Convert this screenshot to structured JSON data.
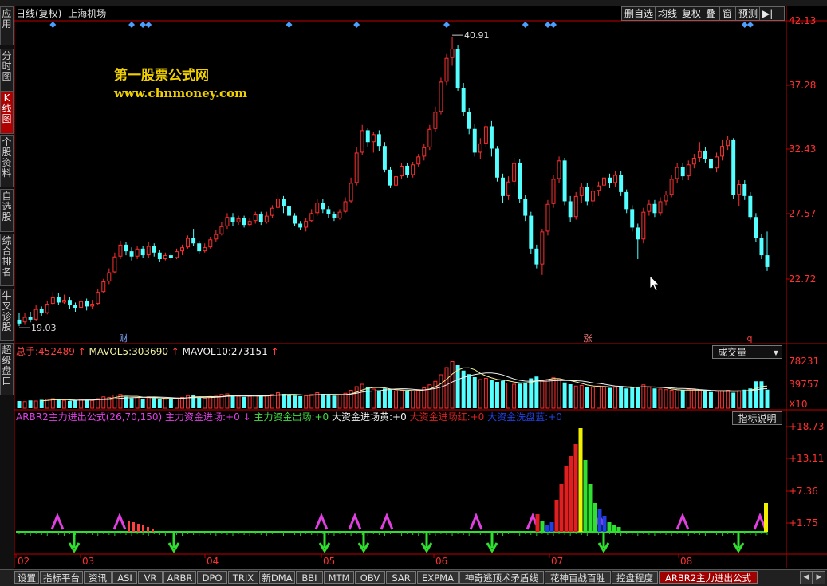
{
  "title": {
    "period": "日线(复权)",
    "stock": "上海机场"
  },
  "toolbar": [
    "删自选",
    "均线",
    "复权",
    "叠",
    "窗",
    "预测"
  ],
  "sidebar": [
    {
      "label": "应\n用"
    },
    {
      "label": "分\n时\n图"
    },
    {
      "label": "K\n线\n图"
    },
    {
      "label": "个\n股\n资\n料"
    },
    {
      "label": "自\n选\n股"
    },
    {
      "label": "综\n合\n排\n名"
    },
    {
      "label": "牛\n叉\n诊\n股"
    },
    {
      "label": "超\n级\n盘\n口"
    }
  ],
  "watermark": {
    "line1": "第一股票公式网",
    "line2": "www.chnmoney.com"
  },
  "price_axis": [
    "42.13",
    "37.28",
    "32.43",
    "27.57",
    "22.72"
  ],
  "price_annotations": {
    "high": "40.91",
    "low": "19.03"
  },
  "event_markers": [
    "财",
    "涨",
    "q"
  ],
  "volume_panel": {
    "label_total": "总手:",
    "total": "452489",
    "ma5_label": "MAVOL5:",
    "ma5": "303690",
    "ma10_label": "MAVOL10:",
    "ma10": "273151",
    "selector": "成交量",
    "axis": [
      "78231",
      "39757",
      "X10"
    ]
  },
  "indicator_panel": {
    "name": "ARBR2主力进出公式(26,70,150)",
    "items": [
      {
        "label": "主力资金进场:",
        "value": "+0",
        "color": "#e040e0"
      },
      {
        "label": "主力资金出场:",
        "value": "+0",
        "color": "#40e040"
      },
      {
        "label": "大资金进场黄:",
        "value": "+0",
        "color": "#f0f0f0"
      },
      {
        "label": "大资金进场红:",
        "value": "+0",
        "color": "#e02020"
      },
      {
        "label": "大资金洗盘蓝:",
        "value": "+0",
        "color": "#2040e0"
      }
    ],
    "button": "指标说明",
    "axis": [
      "+18.73",
      "+13.11",
      "+7.36",
      "+1.75"
    ]
  },
  "months": [
    "02",
    "03",
    "04",
    "05",
    "06",
    "07",
    "08"
  ],
  "bottom_tabs": [
    "设置",
    "指标平台",
    "资讯",
    "ASI",
    "VR",
    "ARBR",
    "DPO",
    "TRIX",
    "新DMA",
    "BBI",
    "MTM",
    "OBV",
    "SAR",
    "EXPMA",
    "神奇逃顶术矛盾线",
    "花神百战百胜",
    "控盘程度",
    "ARBR2主力进出公式"
  ],
  "colors": {
    "up": "#ff3030",
    "down": "#54ffff",
    "axis": "#c00000",
    "bg": "#000000"
  },
  "chart_data": {
    "type": "candlestick",
    "price_range": [
      19.03,
      42.13
    ],
    "candles": [
      [
        19.4,
        19.1,
        19.9,
        18.9
      ],
      [
        19.2,
        19.6,
        19.9,
        19.0
      ],
      [
        19.6,
        19.4,
        20.0,
        19.2
      ],
      [
        19.4,
        20.2,
        20.5,
        19.3
      ],
      [
        20.2,
        19.9,
        20.4,
        19.7
      ],
      [
        19.9,
        20.6,
        20.8,
        19.8
      ],
      [
        20.6,
        21.1,
        21.5,
        20.5
      ],
      [
        21.1,
        20.7,
        21.4,
        20.5
      ],
      [
        20.7,
        20.9,
        21.3,
        20.6
      ],
      [
        20.9,
        20.5,
        21.1,
        20.2
      ],
      [
        20.5,
        20.3,
        20.7,
        20.0
      ],
      [
        20.3,
        20.8,
        21.0,
        20.2
      ],
      [
        20.8,
        20.4,
        21.0,
        20.1
      ],
      [
        20.4,
        20.6,
        20.9,
        20.2
      ],
      [
        20.6,
        21.5,
        21.7,
        20.5
      ],
      [
        21.5,
        22.3,
        22.5,
        21.4
      ],
      [
        22.3,
        23.0,
        23.3,
        22.1
      ],
      [
        23.0,
        24.2,
        24.5,
        22.9
      ],
      [
        24.2,
        25.1,
        25.4,
        24.0
      ],
      [
        25.1,
        24.6,
        25.3,
        24.3
      ],
      [
        24.6,
        24.2,
        24.9,
        23.9
      ],
      [
        24.2,
        24.8,
        25.0,
        24.0
      ],
      [
        24.8,
        24.3,
        25.0,
        24.1
      ],
      [
        24.3,
        25.0,
        25.3,
        24.1
      ],
      [
        25.0,
        24.5,
        25.2,
        24.2
      ],
      [
        24.5,
        24.0,
        24.7,
        23.8
      ],
      [
        24.0,
        24.3,
        24.5,
        23.9
      ],
      [
        24.3,
        24.1,
        24.5,
        23.9
      ],
      [
        24.1,
        24.6,
        24.8,
        24.0
      ],
      [
        24.6,
        24.9,
        25.1,
        24.3
      ],
      [
        24.9,
        25.6,
        25.8,
        24.8
      ],
      [
        25.6,
        25.2,
        26.3,
        25.0
      ],
      [
        25.2,
        24.6,
        25.4,
        24.4
      ],
      [
        24.6,
        24.9,
        25.2,
        24.5
      ],
      [
        24.9,
        25.5,
        25.7,
        24.8
      ],
      [
        25.5,
        25.9,
        26.2,
        25.3
      ],
      [
        25.9,
        26.5,
        26.8,
        25.8
      ],
      [
        26.5,
        27.2,
        27.5,
        26.3
      ],
      [
        27.2,
        26.8,
        27.5,
        26.5
      ],
      [
        26.8,
        27.1,
        27.3,
        26.6
      ],
      [
        27.1,
        26.6,
        27.3,
        26.4
      ],
      [
        26.6,
        26.9,
        27.1,
        26.5
      ],
      [
        26.9,
        27.4,
        27.6,
        26.7
      ],
      [
        27.4,
        26.8,
        27.6,
        26.6
      ],
      [
        26.8,
        27.3,
        27.6,
        26.7
      ],
      [
        27.3,
        27.9,
        28.1,
        27.1
      ],
      [
        27.9,
        28.6,
        29.0,
        27.7
      ],
      [
        28.6,
        28.0,
        28.8,
        27.5
      ],
      [
        28.0,
        27.3,
        28.1,
        27.1
      ],
      [
        27.3,
        26.7,
        27.5,
        26.5
      ],
      [
        26.7,
        26.4,
        26.9,
        26.2
      ],
      [
        26.4,
        26.9,
        27.1,
        26.1
      ],
      [
        26.9,
        27.5,
        27.8,
        26.8
      ],
      [
        27.5,
        28.3,
        28.6,
        27.3
      ],
      [
        28.3,
        27.8,
        28.6,
        27.5
      ],
      [
        27.8,
        27.4,
        28.0,
        27.1
      ],
      [
        27.4,
        27.1,
        27.6,
        26.9
      ],
      [
        27.1,
        27.6,
        27.8,
        27.0
      ],
      [
        27.6,
        28.4,
        28.7,
        27.5
      ],
      [
        28.4,
        29.8,
        30.2,
        28.3
      ],
      [
        29.8,
        32.1,
        32.5,
        29.6
      ],
      [
        32.1,
        33.8,
        34.2,
        31.9
      ],
      [
        33.8,
        32.9,
        34.0,
        32.5
      ],
      [
        32.9,
        33.5,
        33.7,
        32.1
      ],
      [
        33.5,
        32.6,
        33.8,
        32.2
      ],
      [
        32.6,
        30.8,
        32.9,
        30.6
      ],
      [
        30.8,
        29.6,
        31.0,
        29.4
      ],
      [
        29.6,
        30.3,
        30.5,
        29.4
      ],
      [
        30.3,
        31.1,
        31.3,
        30.1
      ],
      [
        31.1,
        30.4,
        31.3,
        30.2
      ],
      [
        30.4,
        31.2,
        31.4,
        30.2
      ],
      [
        31.2,
        31.8,
        32.0,
        31.0
      ],
      [
        31.8,
        32.5,
        32.8,
        31.5
      ],
      [
        32.5,
        33.9,
        34.2,
        32.3
      ],
      [
        33.9,
        35.2,
        35.6,
        33.7
      ],
      [
        35.2,
        37.5,
        37.8,
        35.0
      ],
      [
        37.5,
        39.3,
        39.6,
        37.2
      ],
      [
        39.3,
        40.0,
        40.91,
        38.7
      ],
      [
        40.0,
        37.0,
        40.3,
        36.8
      ],
      [
        37.0,
        35.2,
        37.4,
        34.9
      ],
      [
        35.2,
        33.9,
        35.5,
        33.5
      ],
      [
        33.9,
        32.1,
        34.3,
        31.8
      ],
      [
        32.1,
        32.8,
        33.2,
        31.6
      ],
      [
        32.8,
        34.1,
        34.4,
        32.5
      ],
      [
        34.1,
        32.4,
        34.5,
        31.8
      ],
      [
        32.4,
        30.2,
        32.6,
        29.9
      ],
      [
        30.2,
        28.8,
        30.5,
        28.3
      ],
      [
        28.8,
        29.9,
        30.3,
        28.5
      ],
      [
        29.9,
        31.3,
        31.7,
        29.6
      ],
      [
        31.3,
        28.6,
        31.6,
        28.3
      ],
      [
        28.6,
        27.3,
        28.9,
        26.9
      ],
      [
        27.3,
        24.8,
        27.6,
        24.4
      ],
      [
        24.8,
        23.6,
        25.1,
        23.3
      ],
      [
        23.6,
        26.1,
        26.3,
        22.8
      ],
      [
        26.1,
        28.2,
        28.5,
        25.8
      ],
      [
        28.2,
        30.1,
        30.4,
        27.9
      ],
      [
        30.1,
        31.5,
        31.8,
        29.8
      ],
      [
        31.5,
        28.4,
        31.7,
        28.1
      ],
      [
        28.4,
        27.2,
        28.8,
        26.8
      ],
      [
        27.2,
        28.8,
        29.1,
        27.0
      ],
      [
        28.8,
        29.5,
        29.8,
        28.3
      ],
      [
        29.5,
        28.4,
        29.8,
        28.1
      ],
      [
        28.4,
        29.2,
        29.5,
        28.0
      ],
      [
        29.2,
        29.6,
        29.9,
        28.8
      ],
      [
        29.6,
        30.2,
        30.5,
        29.3
      ],
      [
        30.2,
        29.8,
        30.5,
        29.4
      ],
      [
        29.8,
        30.4,
        30.7,
        29.5
      ],
      [
        30.4,
        29.1,
        30.7,
        28.8
      ],
      [
        29.1,
        27.8,
        29.3,
        27.5
      ],
      [
        27.8,
        26.4,
        28.1,
        26.1
      ],
      [
        26.4,
        25.5,
        26.7,
        24.0
      ],
      [
        25.5,
        27.6,
        27.9,
        25.2
      ],
      [
        27.6,
        28.2,
        28.5,
        27.3
      ],
      [
        28.2,
        27.5,
        28.5,
        27.2
      ],
      [
        27.5,
        28.4,
        28.7,
        27.3
      ],
      [
        28.4,
        28.9,
        29.2,
        28.1
      ],
      [
        28.9,
        30.1,
        30.4,
        28.7
      ],
      [
        30.1,
        31.0,
        31.3,
        29.8
      ],
      [
        31.0,
        30.3,
        31.3,
        30.0
      ],
      [
        30.3,
        31.2,
        31.5,
        30.0
      ],
      [
        31.2,
        31.7,
        32.0,
        30.9
      ],
      [
        31.7,
        32.2,
        32.9,
        31.4
      ],
      [
        32.2,
        31.6,
        32.5,
        31.3
      ],
      [
        31.6,
        30.9,
        31.9,
        30.6
      ],
      [
        30.9,
        31.8,
        32.1,
        30.6
      ],
      [
        31.8,
        32.6,
        33.1,
        31.5
      ],
      [
        32.6,
        33.1,
        33.4,
        32.3
      ],
      [
        33.1,
        28.9,
        33.2,
        28.6
      ],
      [
        28.9,
        29.7,
        30.0,
        28.0
      ],
      [
        29.7,
        28.8,
        30.0,
        28.5
      ],
      [
        28.8,
        27.2,
        29.1,
        27.0
      ],
      [
        27.2,
        25.6,
        27.5,
        25.3
      ],
      [
        25.6,
        24.3,
        25.9,
        24.0
      ],
      [
        24.3,
        23.4,
        26.1,
        23.1
      ]
    ],
    "volume": [
      1.2,
      1.1,
      1.3,
      1.2,
      1.4,
      1.5,
      1.6,
      1.4,
      1.3,
      1.2,
      1.3,
      1.5,
      1.4,
      1.3,
      1.6,
      1.9,
      1.8,
      2.2,
      2.3,
      1.9,
      1.7,
      1.8,
      1.6,
      1.9,
      1.7,
      1.6,
      1.5,
      1.6,
      1.7,
      1.8,
      2.1,
      2.2,
      1.8,
      1.7,
      1.9,
      2.0,
      2.3,
      2.4,
      2.1,
      2.0,
      1.9,
      2.0,
      2.2,
      2.0,
      2.1,
      2.3,
      2.6,
      2.4,
      2.2,
      2.1,
      2.0,
      2.1,
      2.3,
      2.6,
      2.4,
      2.2,
      2.1,
      2.2,
      2.5,
      3.0,
      3.6,
      4.0,
      3.5,
      3.2,
      3.0,
      3.3,
      3.1,
      2.9,
      3.0,
      2.8,
      2.9,
      3.1,
      3.4,
      3.9,
      4.5,
      5.6,
      6.8,
      7.8,
      7.2,
      6.3,
      5.7,
      5.2,
      4.8,
      5.0,
      4.7,
      4.4,
      4.6,
      4.2,
      4.0,
      4.1,
      4.3,
      5.0,
      5.3,
      4.6,
      4.8,
      5.1,
      4.9,
      4.3,
      4.0,
      3.7,
      3.8,
      3.6,
      3.5,
      3.7,
      3.6,
      3.4,
      3.5,
      3.7,
      3.3,
      3.4,
      3.6,
      3.9,
      3.5,
      3.3,
      3.2,
      3.1,
      3.0,
      2.9,
      3.0,
      3.2,
      3.1,
      2.9,
      2.8,
      2.7,
      2.8,
      2.9,
      3.0,
      2.6,
      2.9,
      3.1,
      3.3,
      4.5,
      4.5,
      3.1
    ],
    "indicator": [
      0,
      0,
      0,
      0,
      0,
      0,
      0,
      0,
      0,
      0,
      0,
      0,
      0,
      0,
      0,
      0,
      0,
      0,
      0,
      0,
      0,
      0,
      0,
      0,
      0,
      0,
      0,
      0,
      0,
      0,
      0,
      0,
      0,
      0,
      0,
      0,
      0,
      0,
      0,
      0,
      0,
      0,
      0,
      0,
      0,
      0,
      0,
      0,
      0,
      0,
      0,
      0,
      0,
      0,
      0,
      0,
      0,
      0,
      0,
      0,
      0,
      0,
      0,
      0,
      0,
      0,
      0,
      0,
      0,
      0,
      0,
      0,
      0,
      0,
      0,
      0,
      0,
      0,
      0,
      0,
      0,
      0,
      0,
      0,
      0,
      0,
      0,
      0,
      0,
      0,
      0,
      0,
      0,
      0,
      0,
      0,
      0,
      0,
      0,
      0,
      0,
      0,
      0,
      0,
      0,
      0,
      0,
      0,
      0,
      0,
      0,
      0,
      0,
      0,
      0,
      0,
      0,
      0,
      0,
      0,
      0,
      0,
      0,
      0,
      0,
      0,
      0,
      0,
      0,
      0,
      0,
      0,
      0,
      0,
      0,
      0
    ]
  }
}
